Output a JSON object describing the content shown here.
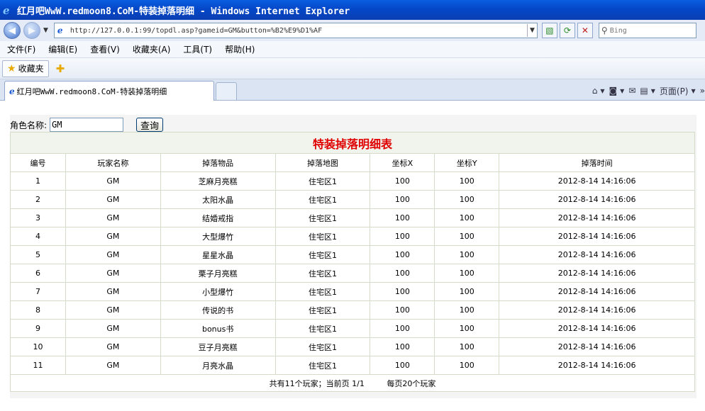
{
  "window": {
    "title": "红月吧WwW.redmoon8.CoM-特装掉落明细 - Windows Internet Explorer"
  },
  "address": {
    "url": "http://127.0.0.1:99/topdl.asp?gameid=GM&button=%B2%E9%D1%AF",
    "search_placeholder": "Bing"
  },
  "menu": [
    "文件(F)",
    "编辑(E)",
    "查看(V)",
    "收藏夹(A)",
    "工具(T)",
    "帮助(H)"
  ],
  "favorites": {
    "label": "收藏夹"
  },
  "tab": {
    "label": "红月吧WwW.redmoon8.CoM-特装掉落明细"
  },
  "commands": {
    "page_label": "页面(P)"
  },
  "form": {
    "role_label": "角色名称:",
    "role_value": "GM",
    "query_label": "查询"
  },
  "table": {
    "caption": "特装掉落明细表",
    "headers": [
      "编号",
      "玩家名称",
      "掉落物品",
      "掉落地图",
      "坐标X",
      "坐标Y",
      "掉落时间"
    ],
    "rows": [
      [
        "1",
        "GM",
        "芝麻月亮糕",
        "住宅区1",
        "100",
        "100",
        "2012-8-14 14:16:06"
      ],
      [
        "2",
        "GM",
        "太阳水晶",
        "住宅区1",
        "100",
        "100",
        "2012-8-14 14:16:06"
      ],
      [
        "3",
        "GM",
        "结婚戒指",
        "住宅区1",
        "100",
        "100",
        "2012-8-14 14:16:06"
      ],
      [
        "4",
        "GM",
        "大型爆竹",
        "住宅区1",
        "100",
        "100",
        "2012-8-14 14:16:06"
      ],
      [
        "5",
        "GM",
        "星星水晶",
        "住宅区1",
        "100",
        "100",
        "2012-8-14 14:16:06"
      ],
      [
        "6",
        "GM",
        "栗子月亮糕",
        "住宅区1",
        "100",
        "100",
        "2012-8-14 14:16:06"
      ],
      [
        "7",
        "GM",
        "小型爆竹",
        "住宅区1",
        "100",
        "100",
        "2012-8-14 14:16:06"
      ],
      [
        "8",
        "GM",
        "传说的书",
        "住宅区1",
        "100",
        "100",
        "2012-8-14 14:16:06"
      ],
      [
        "9",
        "GM",
        "bonus书",
        "住宅区1",
        "100",
        "100",
        "2012-8-14 14:16:06"
      ],
      [
        "10",
        "GM",
        "豆子月亮糕",
        "住宅区1",
        "100",
        "100",
        "2012-8-14 14:16:06"
      ],
      [
        "11",
        "GM",
        "月亮水晶",
        "住宅区1",
        "100",
        "100",
        "2012-8-14 14:16:06"
      ]
    ],
    "footer": {
      "summary": "共有11个玩家；当前页 1/1",
      "per_page": "每页20个玩家"
    }
  }
}
